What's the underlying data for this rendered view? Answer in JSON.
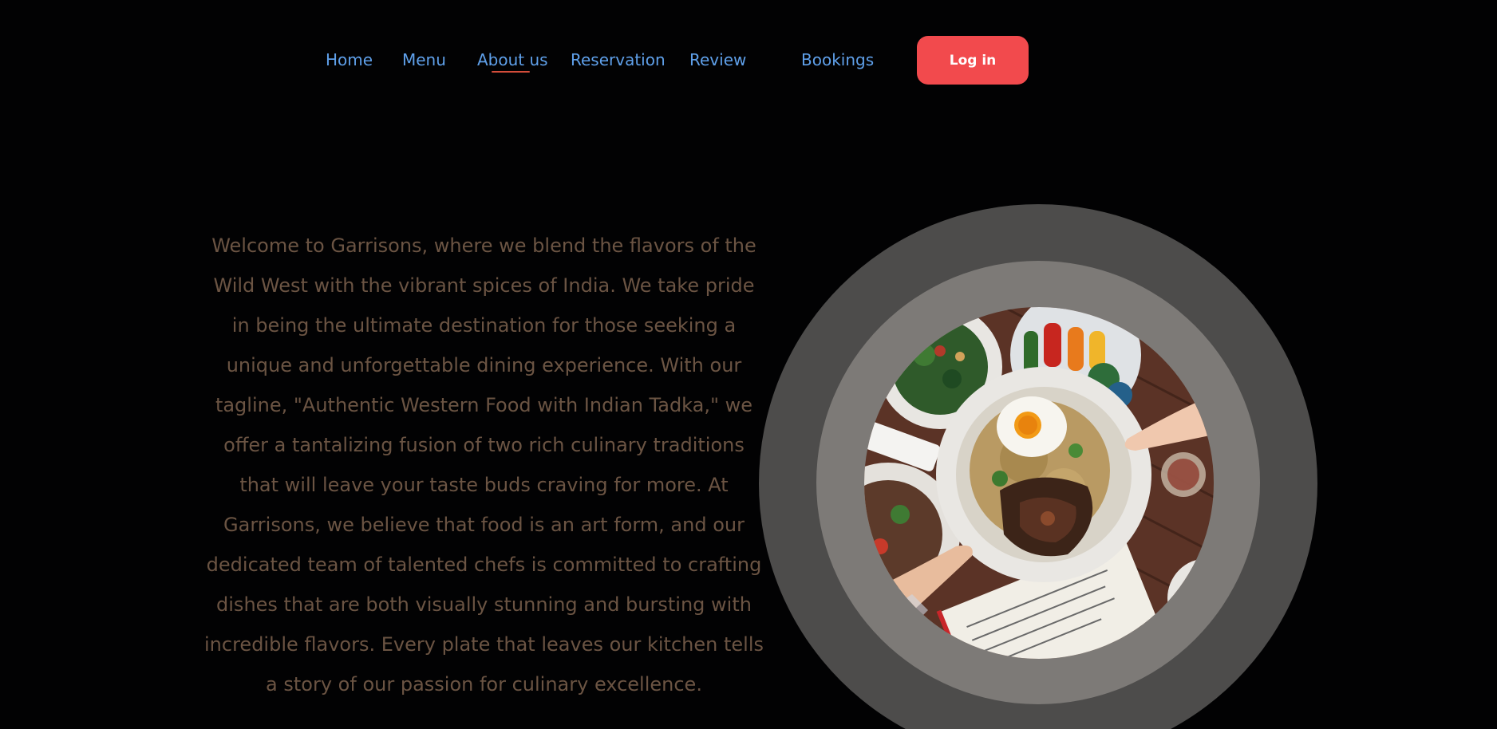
{
  "nav": {
    "items": [
      {
        "label": "Home"
      },
      {
        "label": "Menu"
      },
      {
        "label": "About us",
        "active": true
      },
      {
        "label": "Reservation"
      },
      {
        "label": "Review"
      },
      {
        "label": "Bookings"
      }
    ],
    "login_label": "Log in"
  },
  "about": {
    "body": "Welcome to Garrisons, where we blend the flavors of the Wild West with the vibrant spices of India. We take pride in being the ultimate destination for those seeking a unique and unforgettable dining experience. With our tagline, \"Authentic Western Food with Indian Tadka,\" we offer a tantalizing fusion of two rich culinary traditions that will leave your taste buds craving for more. At Garrisons, we believe that food is an art form, and our dedicated team of talented chefs is committed to crafting dishes that are both visually stunning and bursting with incredible flavors. Every plate that leaves our kitchen tells a story of our passion for culinary excellence."
  },
  "colors": {
    "background": "#020203",
    "nav_link": "#5fa0ea",
    "active_underline": "#d34c3a",
    "login_button": "#f24a4d",
    "body_text": "#6b5443",
    "ring_outer": "#4d4c4b",
    "ring_inner": "#7d7a77"
  },
  "images": {
    "hero": "food-platter-photo"
  }
}
